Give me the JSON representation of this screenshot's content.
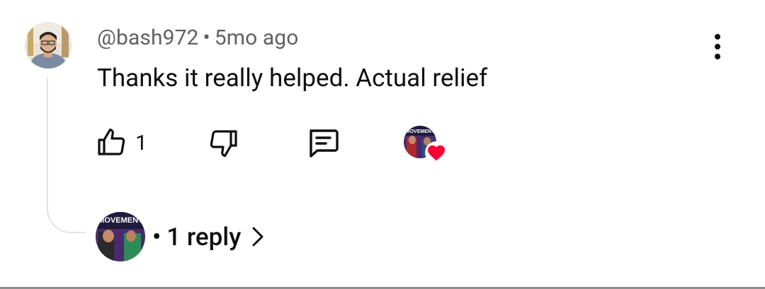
{
  "comment": {
    "author": "@bash972",
    "separator": "•",
    "time_ago": "5mo ago",
    "text": "Thanks it really helped. Actual relief"
  },
  "actions": {
    "like_count": "1",
    "like_icon": "thumb-up-icon",
    "dislike_icon": "thumb-down-icon",
    "reply_icon": "comment-icon",
    "more_icon": "more-vertical-icon"
  },
  "creator_heart": {
    "avatar_logo_text": "MOVEMENT",
    "heart_color": "#ff0033"
  },
  "replies": {
    "separator": "•",
    "label": "1 reply"
  },
  "colors": {
    "text_primary": "#0f0f0f",
    "text_secondary": "#606060",
    "thread_line": "#e3e3e3"
  }
}
